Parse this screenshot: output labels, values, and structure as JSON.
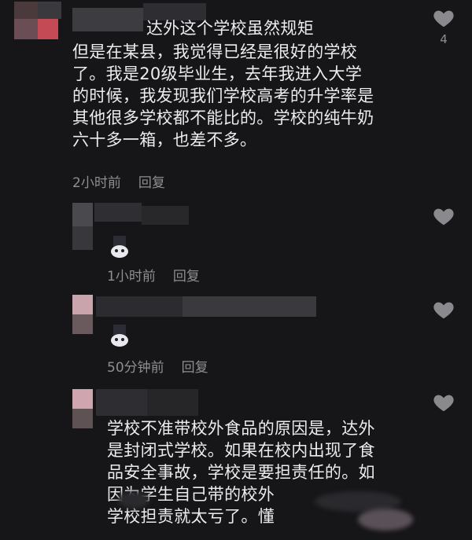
{
  "comments": [
    {
      "text_line1": "达外这个学校虽然规矩",
      "text_rest": "但是在某县，我觉得已经是很好的学校\n了。我是20级毕业生，去年我进入大学\n的时候，我发现我们学校高考的升学率是\n其他很多学校都不能比的。学校的纯牛奶\n六十多一箱，也差不多。",
      "time": "2小时前",
      "reply": "回复",
      "like_count": "4"
    },
    {
      "time": "1小时前",
      "reply": "回复"
    },
    {
      "time": "50分钟前",
      "reply": "回复"
    },
    {
      "text": "学校不准带校外食品的原因是，达外\n是封闭式学校。如果在校内出现了食\n品安全事故，学校是要担责任的。如\n因为学生自己带的校外\n学校担责就太亏了。懂",
      "time": "",
      "reply": ""
    }
  ],
  "colors": {
    "background": "#161618",
    "text": "#ececef",
    "meta": "#8e8e93",
    "heart": "#8a8a8e"
  },
  "icons": [
    "heart-icon",
    "emoji-sticker-icon"
  ]
}
